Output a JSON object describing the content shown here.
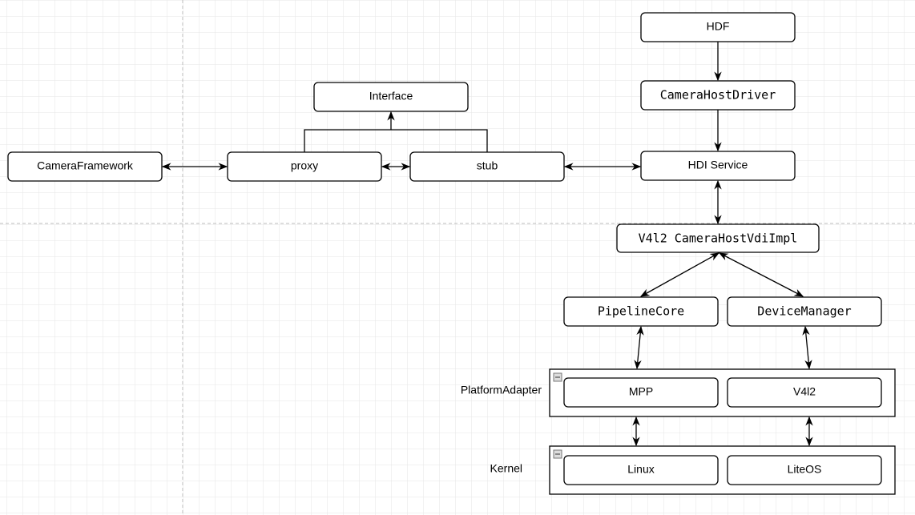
{
  "nodes": {
    "hdf": "HDF",
    "camera_host_driver": "CameraHostDriver",
    "hdi_service": "HDI Service",
    "vdi_impl": "V4l2 CameraHostVdiImpl",
    "pipeline_core": "PipelineCore",
    "device_manager": "DeviceManager",
    "mpp": "MPP",
    "v4l2": "V4l2",
    "linux": "Linux",
    "liteos": "LiteOS",
    "interface": "Interface",
    "proxy": "proxy",
    "stub": "stub",
    "camera_framework": "CameraFramework"
  },
  "groups": {
    "platform_adapter": "PlatformAdapter",
    "kernel": "Kernel"
  },
  "colors": {
    "grid": "#e6e6e6",
    "stroke": "#000000"
  }
}
